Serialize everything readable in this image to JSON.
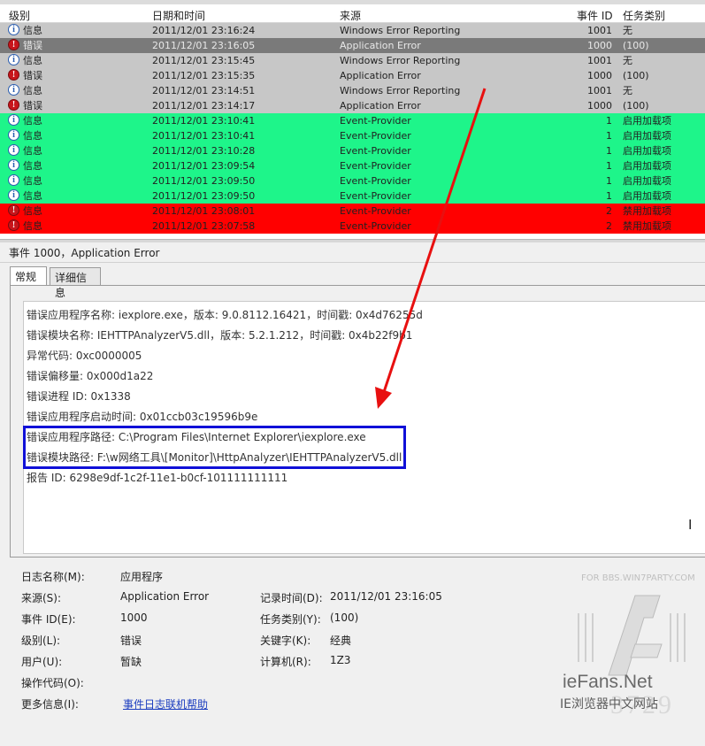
{
  "columns": {
    "level": "级别",
    "datetime": "日期和时间",
    "source": "来源",
    "event_id": "事件 ID",
    "task": "任务类别"
  },
  "rows": [
    {
      "level": "信息",
      "icon": "info-icon",
      "datetime": "2011/12/01 23:16:24",
      "source": "Windows Error Reporting",
      "event_id": "1001",
      "task": "无",
      "style": "gray"
    },
    {
      "level": "错误",
      "icon": "error-icon",
      "datetime": "2011/12/01 23:16:05",
      "source": "Application Error",
      "event_id": "1000",
      "task": "(100)",
      "style": "selected"
    },
    {
      "level": "信息",
      "icon": "info-icon",
      "datetime": "2011/12/01 23:15:45",
      "source": "Windows Error Reporting",
      "event_id": "1001",
      "task": "无",
      "style": "gray"
    },
    {
      "level": "错误",
      "icon": "error-icon",
      "datetime": "2011/12/01 23:15:35",
      "source": "Application Error",
      "event_id": "1000",
      "task": "(100)",
      "style": "gray"
    },
    {
      "level": "信息",
      "icon": "info-icon",
      "datetime": "2011/12/01 23:14:51",
      "source": "Windows Error Reporting",
      "event_id": "1001",
      "task": "无",
      "style": "gray"
    },
    {
      "level": "错误",
      "icon": "error-icon",
      "datetime": "2011/12/01 23:14:17",
      "source": "Application Error",
      "event_id": "1000",
      "task": "(100)",
      "style": "gray"
    },
    {
      "level": "信息",
      "icon": "info-icon",
      "datetime": "2011/12/01 23:10:41",
      "source": "Event-Provider",
      "event_id": "1",
      "task": "启用加载项",
      "style": "green"
    },
    {
      "level": "信息",
      "icon": "info-icon",
      "datetime": "2011/12/01 23:10:41",
      "source": "Event-Provider",
      "event_id": "1",
      "task": "启用加载项",
      "style": "green"
    },
    {
      "level": "信息",
      "icon": "info-icon",
      "datetime": "2011/12/01 23:10:28",
      "source": "Event-Provider",
      "event_id": "1",
      "task": "启用加载项",
      "style": "green"
    },
    {
      "level": "信息",
      "icon": "info-icon",
      "datetime": "2011/12/01 23:09:54",
      "source": "Event-Provider",
      "event_id": "1",
      "task": "启用加载项",
      "style": "green"
    },
    {
      "level": "信息",
      "icon": "info-icon",
      "datetime": "2011/12/01 23:09:50",
      "source": "Event-Provider",
      "event_id": "1",
      "task": "启用加载项",
      "style": "green"
    },
    {
      "level": "信息",
      "icon": "info-icon",
      "datetime": "2011/12/01 23:09:50",
      "source": "Event-Provider",
      "event_id": "1",
      "task": "启用加载项",
      "style": "green"
    },
    {
      "level": "信息",
      "icon": "error-icon",
      "datetime": "2011/12/01 23:08:01",
      "source": "Event-Provider",
      "event_id": "2",
      "task": "禁用加载项",
      "style": "red"
    },
    {
      "level": "信息",
      "icon": "error-icon",
      "datetime": "2011/12/01 23:07:58",
      "source": "Event-Provider",
      "event_id": "2",
      "task": "禁用加载项",
      "style": "red"
    }
  ],
  "row_colors": {
    "gray": "#c7c7c7",
    "selected": "#7a7a7a",
    "green": "#1ef58a",
    "red": "#ff0000"
  },
  "event_title": "事件 1000，Application Error",
  "tabs": {
    "general": "常规",
    "details": "详细信息"
  },
  "description_lines": [
    "错误应用程序名称: iexplore.exe，版本: 9.0.8112.16421，时间戳: 0x4d76255d",
    "错误模块名称: IEHTTPAnalyzerV5.dll，版本: 5.2.1.212，时间戳: 0x4b22f9b1",
    "异常代码: 0xc0000005",
    "错误偏移量: 0x000d1a22",
    "错误进程 ID: 0x1338",
    "错误应用程序启动时间: 0x01ccb03c19596b9e",
    "错误应用程序路径: C:\\Program Files\\Internet Explorer\\iexplore.exe",
    "错误模块路径: F:\\w网络工具\\[Monitor]\\HttpAnalyzer\\IEHTTPAnalyzerV5.dll",
    "报告 ID: 6298e9df-1c2f-11e1-b0cf-101111111111"
  ],
  "properties": {
    "log_name_label": "日志名称(M):",
    "log_name": "应用程序",
    "source_label": "来源(S):",
    "source": "Application Error",
    "logged_label": "记录时间(D):",
    "logged": "2011/12/01 23:16:05",
    "event_id_label": "事件 ID(E):",
    "event_id": "1000",
    "task_label": "任务类别(Y):",
    "task": "(100)",
    "level_label": "级别(L):",
    "level": "错误",
    "keywords_label": "关键字(K):",
    "keywords": "经典",
    "user_label": "用户(U):",
    "user": "暂缺",
    "computer_label": "计算机(R):",
    "computer": "1Z3",
    "opcode_label": "操作代码(O):",
    "more_info_label": "更多信息(I):",
    "more_info_link": "事件日志联机帮助"
  },
  "watermark": {
    "top": "FOR BBS.WIN7PARTY.COM",
    "brand": "ieFans.Net",
    "subtitle": "IE浏览器中文网站",
    "number": "3729"
  },
  "annotation_colors": {
    "arrow": "#e81010",
    "highlight_box": "#1010d8"
  }
}
